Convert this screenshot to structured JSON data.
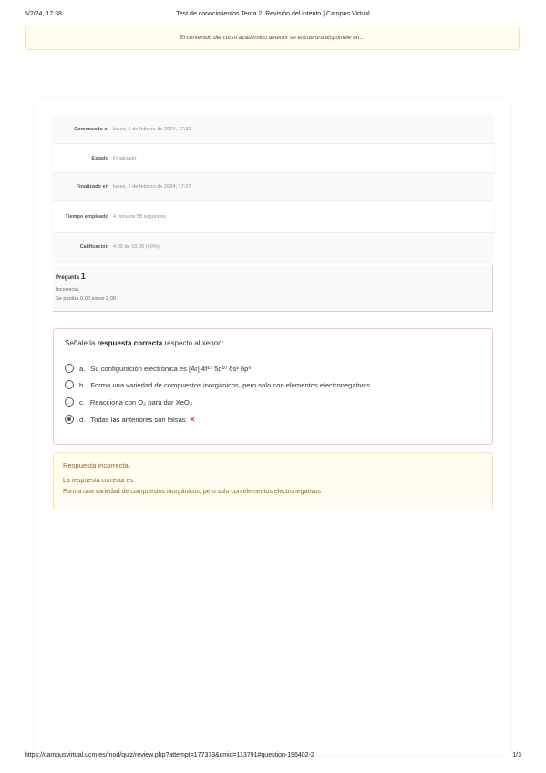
{
  "print_header": {
    "datetime": "5/2/24, 17:38",
    "title": "Test de conocimientos Tema 2: Revisión del intento | Campus Virtual"
  },
  "notice": "El contenido del curso académico anterior se encuentra disponible en...",
  "summary": {
    "rows": [
      {
        "label": "Comenzado el",
        "value": "lunes, 5 de febrero de 2024, 17:32"
      },
      {
        "label": "Estado",
        "value": "Finalizado"
      },
      {
        "label": "Finalizado en",
        "value": "lunes, 5 de febrero de 2024, 17:37"
      },
      {
        "label": "Tiempo empleado",
        "value": "4 minutos 58 segundos"
      },
      {
        "label": "Calificación",
        "value": "4,00 de 10,00 (40%)"
      }
    ]
  },
  "question_info": {
    "label": "Pregunta",
    "number": "1",
    "state": "Incorrecta",
    "grade": "Se puntúa 0,00 sobre 2,00"
  },
  "question": {
    "prompt_pre": "Señale la ",
    "prompt_bold": "respuesta correcta",
    "prompt_post": " respecto al xenon:",
    "options": [
      {
        "letter": "a.",
        "text": "Su configuración electrónica es [Ar] 4f¹⁴ 5d¹⁰ 6s² 6p⁶",
        "checked": false
      },
      {
        "letter": "b.",
        "text": "Forma una variedad de compuestos inorgánicos, pero solo con elementos electronegativos",
        "checked": false
      },
      {
        "letter": "c.",
        "text": "Reacciona con O₂ para dar XeO₃",
        "checked": false
      },
      {
        "letter": "d.",
        "text": "Todas las anteriores son falsas",
        "checked": true,
        "mark": "✕"
      }
    ]
  },
  "feedback": {
    "title": "Respuesta incorrecta.",
    "line1": "La respuesta correcta es:",
    "line2": "Forma una variedad de compuestos inorgánicos, pero solo con elementos electronegativos"
  },
  "print_footer": {
    "url": "https://campusvirtual.ucm.es/mod/quiz/review.php?attempt=177373&cmid=113791#question-196402-2",
    "page": "1/3"
  }
}
